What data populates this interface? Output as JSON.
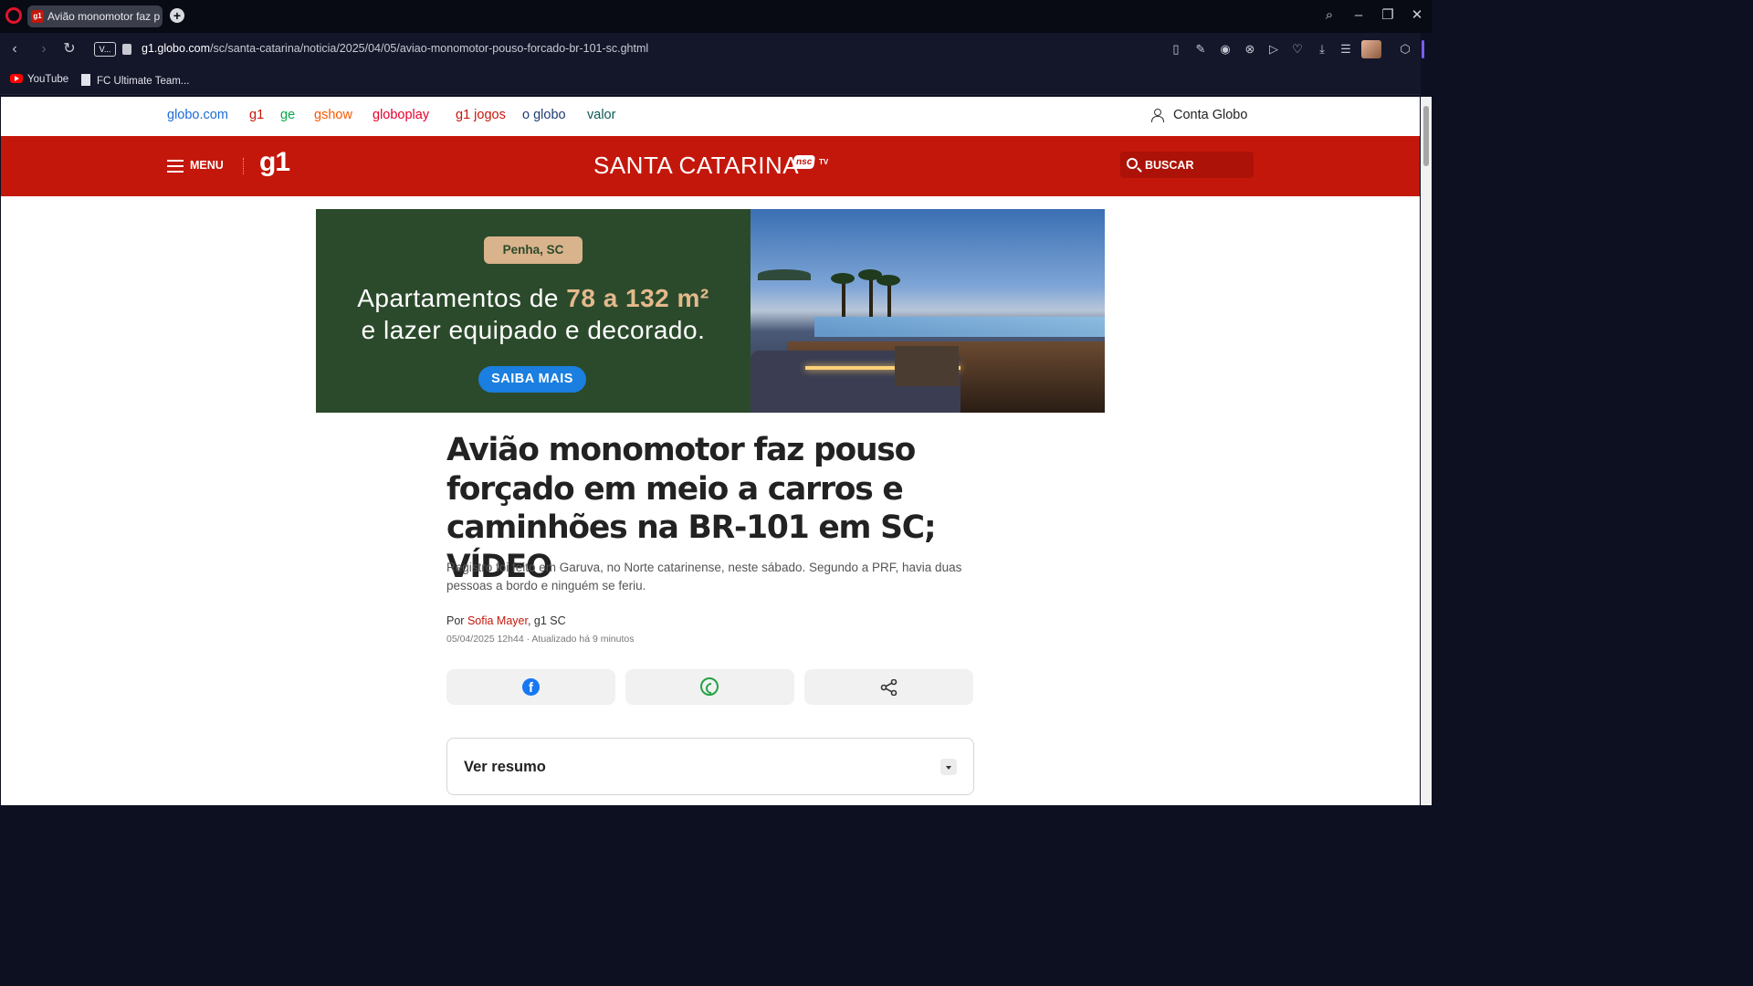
{
  "browser": {
    "tab_title": "Avião monomotor faz p",
    "tab_favicon": "g1",
    "url_host": "g1.globo.com",
    "url_path": "/sc/santa-catarina/noticia/2025/04/05/aviao-monomotor-pouso-forcado-br-101-sc.ghtml",
    "vpn_label": "V..."
  },
  "bookmarks": [
    {
      "label": "YouTube",
      "icon": "youtube-icon"
    },
    {
      "label": "FC Ultimate Team...",
      "icon": "document-icon"
    }
  ],
  "globo_nav": [
    {
      "label": "globo.com",
      "color": "#1c6bd6"
    },
    {
      "label": "g1",
      "color": "#c4170c"
    },
    {
      "label": "ge",
      "color": "#06aa48"
    },
    {
      "label": "gshow",
      "color": "#fa5700"
    },
    {
      "label": "globoplay",
      "color": "#e6002d"
    },
    {
      "label": "g1 jogos",
      "color": "#c4170c"
    },
    {
      "label": "o globo",
      "color": "#1f3b75"
    },
    {
      "label": "valor",
      "color": "#0a5a56"
    }
  ],
  "account": {
    "label": "Conta Globo"
  },
  "header": {
    "menu_label": "MENU",
    "logo": "g1",
    "region": "SANTA CATARINA",
    "partner_a": "nsc",
    "partner_b": "TV",
    "search_label": "BUSCAR",
    "brand_color": "#c4170c"
  },
  "ad": {
    "tag": "Penha, SC",
    "line1_pre": "Apartamentos de ",
    "line1_hl": "78 a 132 m²",
    "line2": "e lazer equipado e decorado.",
    "cta": "SAIBA MAIS"
  },
  "article": {
    "headline": "Avião monomotor faz pouso forçado em meio a carros e caminhões na BR-101 em SC; VÍDEO",
    "subtitle": "Registro foi feito em Garuva, no Norte catarinense, neste sábado. Segundo a PRF, havia duas pessoas a bordo e ninguém se feriu.",
    "by_prefix": "Por ",
    "author": "Sofia Mayer",
    "by_suffix": ", g1 SC",
    "dateline": "05/04/2025 12h44 · Atualizado há 9 minutos",
    "summary_label": "Ver resumo"
  }
}
